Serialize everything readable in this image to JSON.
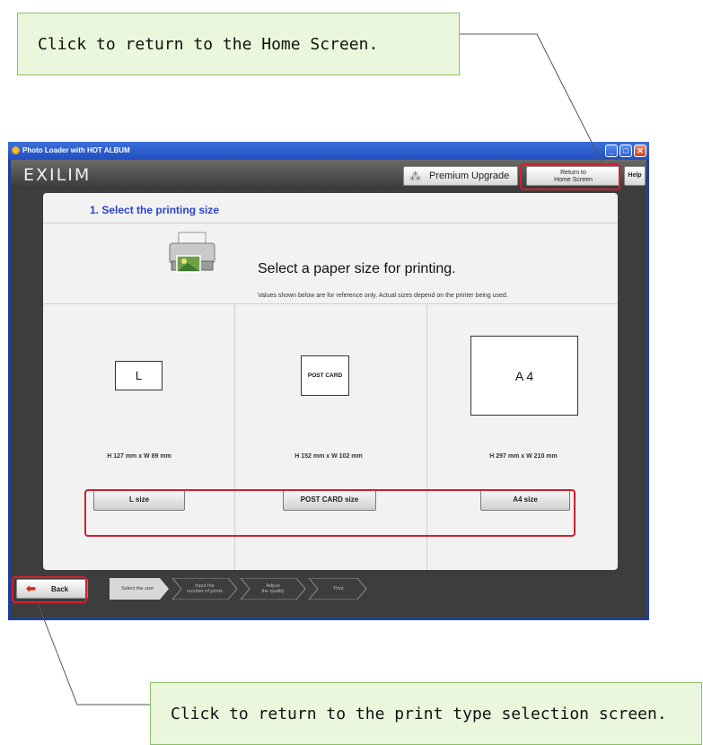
{
  "callouts": {
    "top": "Click to return to the Home Screen.",
    "bottom": "Click to return to the print type selection screen."
  },
  "window": {
    "title": "Photo Loader with HOT ALBUM",
    "controls": [
      "minimize-icon",
      "maximize-icon",
      "close-icon"
    ]
  },
  "header": {
    "logo": "EXILIM",
    "premium_label": "Premium Upgrade",
    "return_label_line1": "Return to",
    "return_label_line2": "Home Screen",
    "help_label": "Help"
  },
  "main": {
    "step_title": "1. Select the printing size",
    "headline": "Select a paper size for printing.",
    "note": "Values shown below are for reference only. Actual sizes depend on the printer being used.",
    "sizes": [
      {
        "box_label": "L",
        "dims": "H 127 mm x W 89 mm",
        "button": "L size"
      },
      {
        "box_label": "POST CARD",
        "dims": "H 152 mm x W 102 mm",
        "button": "POST CARD size"
      },
      {
        "box_label": "A 4",
        "dims": "H 297 mm x W 210 mm",
        "button": "A4 size"
      }
    ]
  },
  "footer": {
    "back_label": "Back",
    "steps": [
      {
        "line1": "Select the size",
        "line2": ""
      },
      {
        "line1": "Input the",
        "line2": "number of prints"
      },
      {
        "line1": "Adjust",
        "line2": "the quality"
      },
      {
        "line1": "Print",
        "line2": ""
      }
    ],
    "active_step": 1
  },
  "colors": {
    "callout_bg": "#ebf7dc",
    "highlight": "#d2202a",
    "step_title": "#2a44cc",
    "back_arrow": "#d42a1a"
  }
}
